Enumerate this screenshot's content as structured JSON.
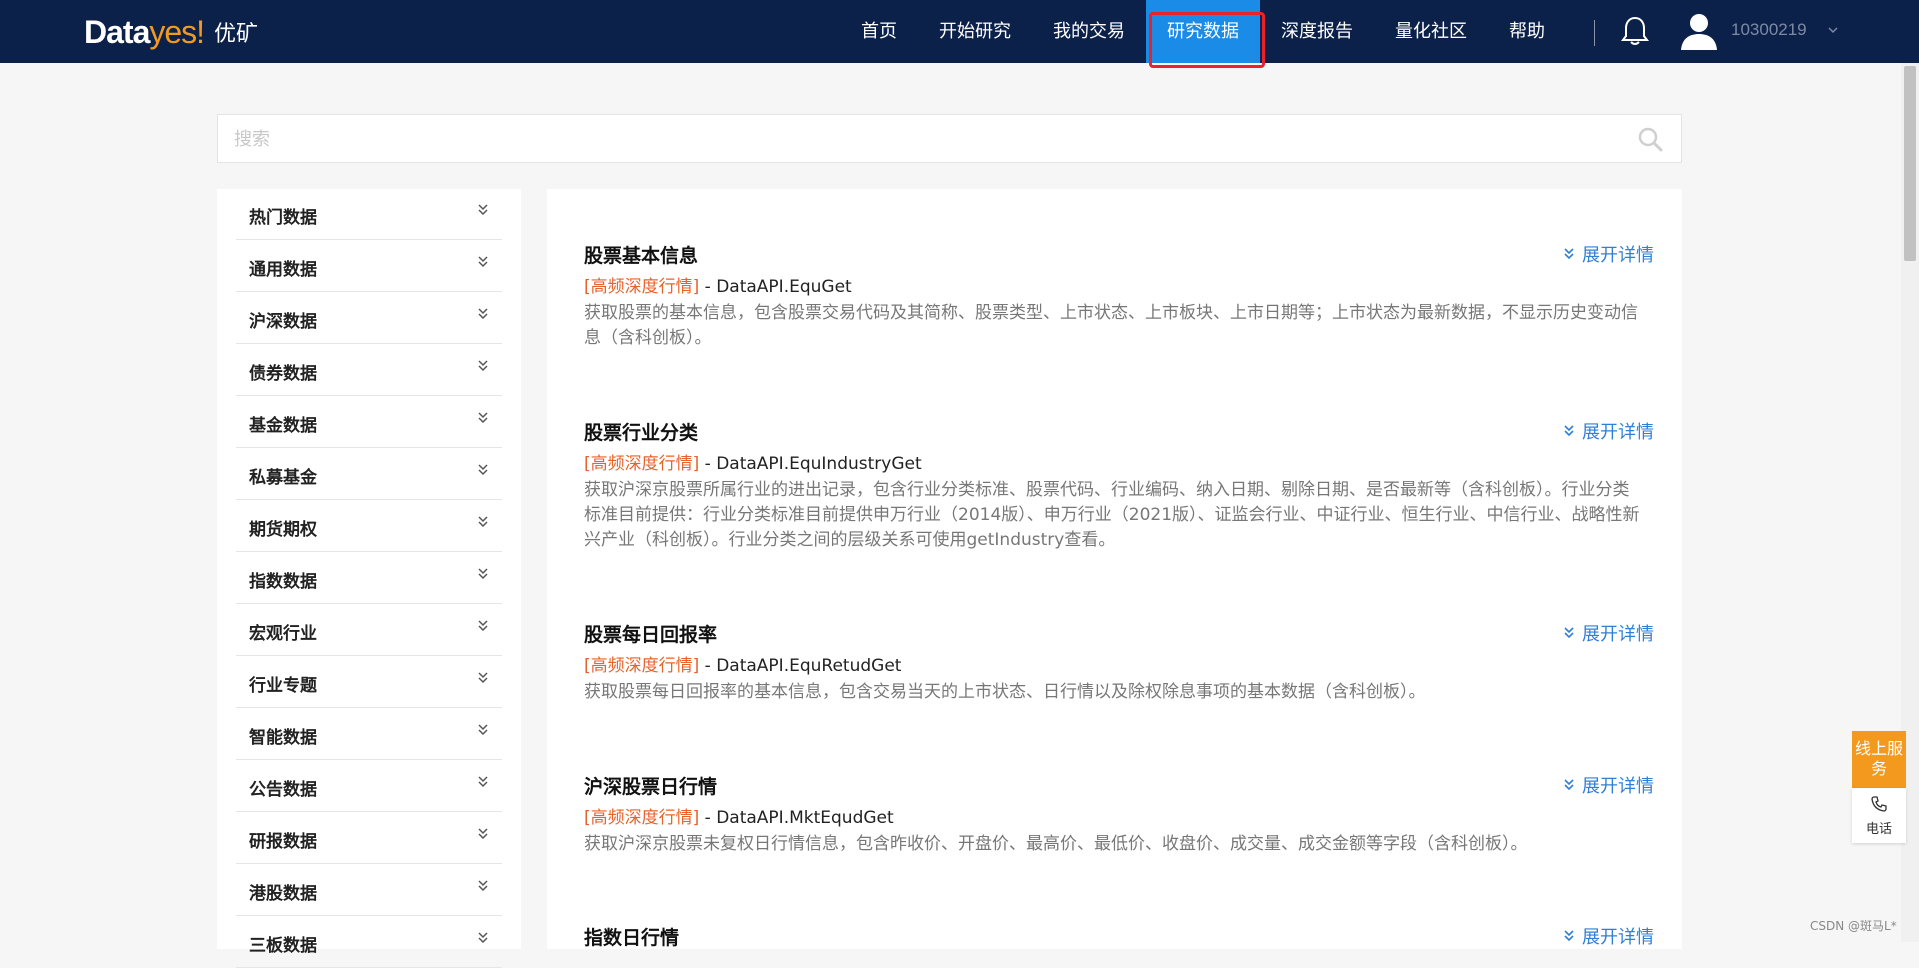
{
  "header": {
    "brand_left": "Data",
    "brand_right": "yes!",
    "brand_cn": "优矿",
    "nav": [
      {
        "label": "首页"
      },
      {
        "label": "开始研究"
      },
      {
        "label": "我的交易"
      },
      {
        "label": "研究数据"
      },
      {
        "label": "深度报告"
      },
      {
        "label": "量化社区"
      },
      {
        "label": "帮助"
      }
    ],
    "active_nav": "研究数据",
    "username": "10300219",
    "icons": {
      "bell": "bell-icon",
      "avatar": "user-avatar-icon",
      "caret": "chevron-down-icon"
    }
  },
  "search": {
    "placeholder": "搜索"
  },
  "sidebar": {
    "items": [
      {
        "label": "热门数据"
      },
      {
        "label": "通用数据"
      },
      {
        "label": "沪深数据"
      },
      {
        "label": "债券数据"
      },
      {
        "label": "基金数据"
      },
      {
        "label": "私募基金"
      },
      {
        "label": "期货期权"
      },
      {
        "label": "指数数据"
      },
      {
        "label": "宏观行业"
      },
      {
        "label": "行业专题"
      },
      {
        "label": "智能数据"
      },
      {
        "label": "公告数据"
      },
      {
        "label": "研报数据"
      },
      {
        "label": "港股数据"
      },
      {
        "label": "三板数据"
      }
    ]
  },
  "main": {
    "expand_label": "展开详情",
    "cards": [
      {
        "title": "股票基本信息",
        "tag": "[高频深度行情]",
        "api": " - DataAPI.EquGet",
        "desc": "获取股票的基本信息，包含股票交易代码及其简称、股票类型、上市状态、上市板块、上市日期等；上市状态为最新数据，不显示历史变动信息（含科创板）。"
      },
      {
        "title": "股票行业分类",
        "tag": "[高频深度行情]",
        "api": " - DataAPI.EquIndustryGet",
        "desc": "获取沪深京股票所属行业的进出记录，包含行业分类标准、股票代码、行业编码、纳入日期、剔除日期、是否最新等（含科创板）。行业分类标准目前提供：行业分类标准目前提供申万行业（2014版）、申万行业（2021版）、证监会行业、中证行业、恒生行业、中信行业、战略性新兴产业（科创板）。行业分类之间的层级关系可使用getIndustry查看。"
      },
      {
        "title": "股票每日回报率",
        "tag": "[高频深度行情]",
        "api": " - DataAPI.EquRetudGet",
        "desc": "获取股票每日回报率的基本信息，包含交易当天的上市状态、日行情以及除权除息事项的基本数据（含科创板）。"
      },
      {
        "title": "沪深股票日行情",
        "tag": "[高频深度行情]",
        "api": " - DataAPI.MktEqudGet",
        "desc": "获取沪深京股票未复权日行情信息，包含昨收价、开盘价、最高价、最低价、收盘价、成交量、成交金额等字段（含科创板）。"
      },
      {
        "title": "指数日行情",
        "tag": "",
        "api": "",
        "desc": ""
      }
    ]
  },
  "service": {
    "online": "线上服务",
    "phone": "电话"
  },
  "watermark": "CSDN @斑马L*"
}
